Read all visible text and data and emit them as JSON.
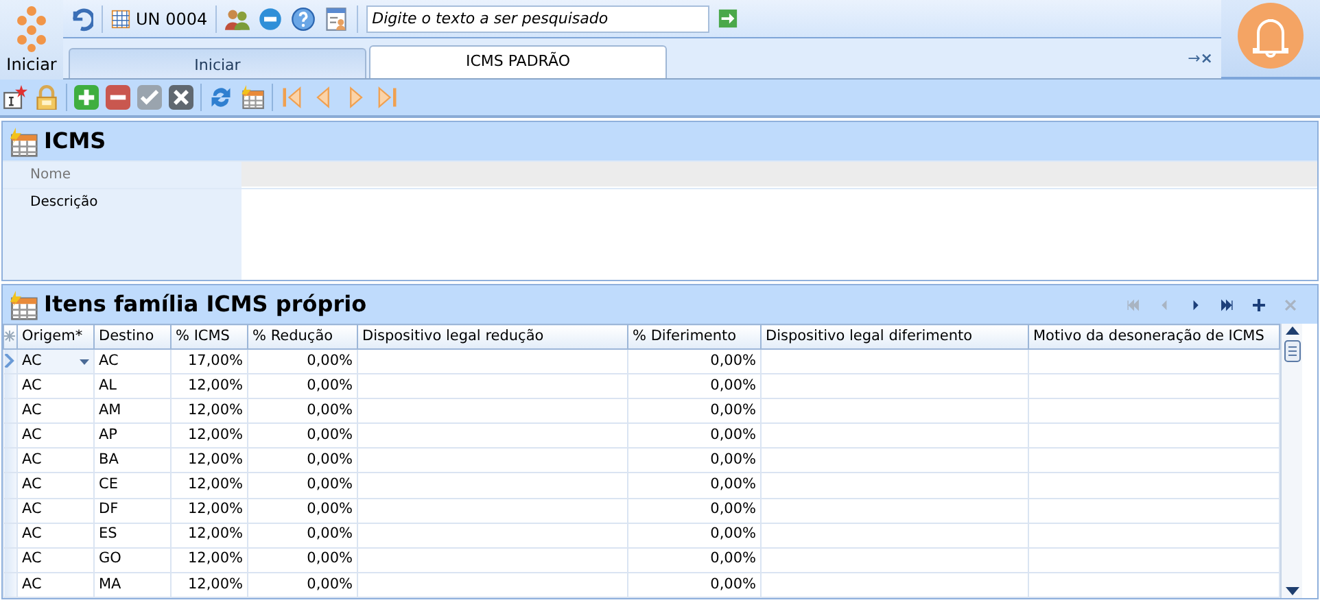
{
  "start_button": {
    "label": "Iniciar"
  },
  "quick_bar": {
    "unit": "UN 0004",
    "search": {
      "placeholder": "Digite o texto a ser pesquisado"
    }
  },
  "tabs": [
    {
      "label": "Iniciar",
      "selected": false
    },
    {
      "label": "ICMS PADRÃO",
      "selected": true
    }
  ],
  "tab_controls": [
    "→",
    "×"
  ],
  "toolbar": [
    {
      "kind": "new"
    },
    {
      "kind": "lock"
    },
    {
      "kind": "sep"
    },
    {
      "kind": "add"
    },
    {
      "kind": "remove"
    },
    {
      "kind": "confirm"
    },
    {
      "kind": "cancel"
    },
    {
      "kind": "sep"
    },
    {
      "kind": "refresh"
    },
    {
      "kind": "grid"
    },
    {
      "kind": "sep"
    },
    {
      "kind": "first"
    },
    {
      "kind": "prev"
    },
    {
      "kind": "next"
    },
    {
      "kind": "last"
    }
  ],
  "form": {
    "title": "ICMS",
    "fields": [
      {
        "label": "Nome",
        "disabled": true
      },
      {
        "label": "Descrição",
        "disabled": false
      }
    ]
  },
  "grid": {
    "title": "Itens família ICMS próprio",
    "navigator": [
      {
        "kind": "first",
        "disabled": true
      },
      {
        "kind": "prev",
        "disabled": true
      },
      {
        "kind": "next",
        "disabled": false
      },
      {
        "kind": "last",
        "disabled": false
      },
      {
        "kind": "add",
        "disabled": false
      },
      {
        "kind": "delete",
        "disabled": true
      }
    ],
    "columns": [
      "Origem*",
      "Destino",
      "% ICMS",
      "% Redução",
      "Dispositivo legal redução",
      "% Diferimento",
      "Dispositivo legal diferimento",
      "Motivo da desoneração de ICMS"
    ],
    "rows": [
      {
        "selected": true,
        "origem": "AC",
        "destino": "AC",
        "icms": "17,00%",
        "reducao": "0,00%",
        "diferimento": "0,00%"
      },
      {
        "selected": false,
        "origem": "AC",
        "destino": "AL",
        "icms": "12,00%",
        "reducao": "0,00%",
        "diferimento": "0,00%"
      },
      {
        "selected": false,
        "origem": "AC",
        "destino": "AM",
        "icms": "12,00%",
        "reducao": "0,00%",
        "diferimento": "0,00%"
      },
      {
        "selected": false,
        "origem": "AC",
        "destino": "AP",
        "icms": "12,00%",
        "reducao": "0,00%",
        "diferimento": "0,00%"
      },
      {
        "selected": false,
        "origem": "AC",
        "destino": "BA",
        "icms": "12,00%",
        "reducao": "0,00%",
        "diferimento": "0,00%"
      },
      {
        "selected": false,
        "origem": "AC",
        "destino": "CE",
        "icms": "12,00%",
        "reducao": "0,00%",
        "diferimento": "0,00%"
      },
      {
        "selected": false,
        "origem": "AC",
        "destino": "DF",
        "icms": "12,00%",
        "reducao": "0,00%",
        "diferimento": "0,00%"
      },
      {
        "selected": false,
        "origem": "AC",
        "destino": "ES",
        "icms": "12,00%",
        "reducao": "0,00%",
        "diferimento": "0,00%"
      },
      {
        "selected": false,
        "origem": "AC",
        "destino": "GO",
        "icms": "12,00%",
        "reducao": "0,00%",
        "diferimento": "0,00%"
      },
      {
        "selected": false,
        "origem": "AC",
        "destino": "MA",
        "icms": "12,00%",
        "reducao": "0,00%",
        "diferimento": "0,00%"
      }
    ]
  }
}
